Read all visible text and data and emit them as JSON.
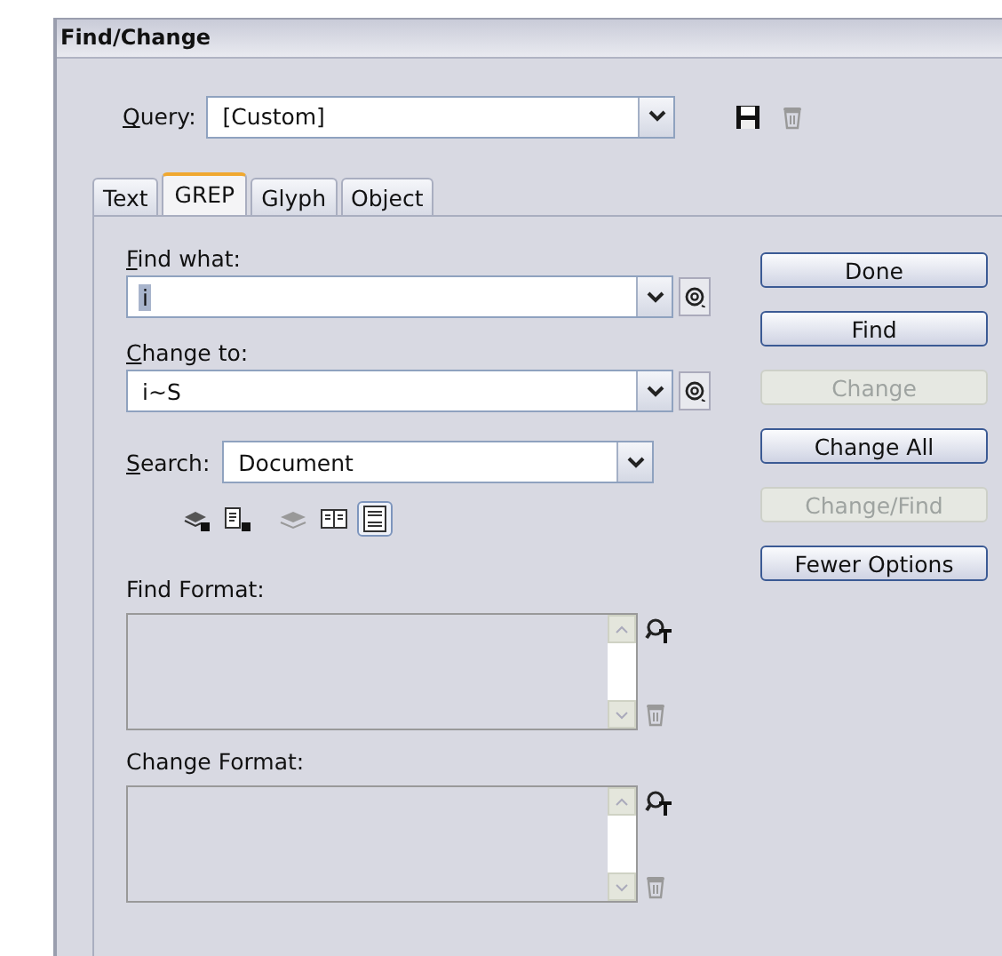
{
  "window": {
    "title": "Find/Change"
  },
  "query": {
    "label": "Query:",
    "mnemonic": true,
    "value": "[Custom]"
  },
  "tabs": [
    {
      "label": "Text",
      "selected": false
    },
    {
      "label": "GREP",
      "selected": true
    },
    {
      "label": "Glyph",
      "selected": false
    },
    {
      "label": "Object",
      "selected": false
    }
  ],
  "find_what": {
    "label": "Find what:",
    "mnemonic": true,
    "value": "i",
    "highlighted": true
  },
  "change_to": {
    "label": "Change to:",
    "mnemonic": true,
    "value": "i~S",
    "highlighted": false
  },
  "search": {
    "label": "Search:",
    "mnemonic": true,
    "value": "Document"
  },
  "search_options": [
    {
      "kind": "locked-layers",
      "selected": false
    },
    {
      "kind": "locked-stories",
      "selected": false
    },
    {
      "kind": "hidden-layers",
      "selected": false
    },
    {
      "kind": "master-pages",
      "selected": false
    },
    {
      "kind": "footnotes",
      "selected": true
    }
  ],
  "find_format": {
    "label": "Find Format:"
  },
  "change_format": {
    "label": "Change Format:"
  },
  "buttons": [
    {
      "label": "Done",
      "disabled": false
    },
    {
      "label": "Find",
      "disabled": false
    },
    {
      "label": "Change",
      "disabled": true
    },
    {
      "label": "Change All",
      "disabled": false
    },
    {
      "label": "Change/Find",
      "disabled": true
    },
    {
      "label": "Fewer Options",
      "disabled": false
    }
  ]
}
